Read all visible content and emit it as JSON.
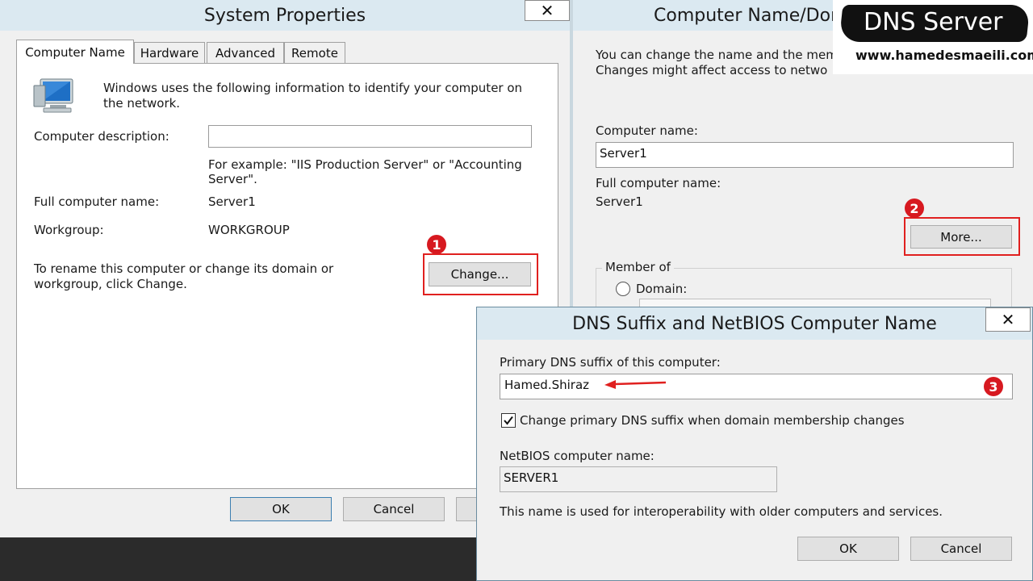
{
  "system_properties": {
    "title": "System Properties",
    "close_glyph": "✕",
    "tabs": [
      {
        "label": "Computer Name"
      },
      {
        "label": "Hardware"
      },
      {
        "label": "Advanced"
      },
      {
        "label": "Remote"
      }
    ],
    "intro_text_line1": "Windows uses the following information to identify your computer on",
    "intro_text_line2": "the network.",
    "description_label": "Computer description:",
    "description_value": "",
    "example_line1": "For example: \"IIS Production Server\" or \"Accounting",
    "example_line2": "Server\".",
    "full_name_label": "Full computer name:",
    "full_name_value": "Server1",
    "workgroup_label": "Workgroup:",
    "workgroup_value": "WORKGROUP",
    "rename_line1": "To rename this computer or change its domain or",
    "rename_line2": "workgroup, click Change.",
    "change_button": "Change...",
    "ok_button": "OK",
    "cancel_button": "Cancel"
  },
  "computer_name_domain": {
    "title": "Computer Name/Dom",
    "text_line1": "You can change the name and the mem",
    "text_line2": "Changes might affect access to netwo",
    "computer_name_label": "Computer name:",
    "computer_name_value": "Server1",
    "full_name_label": "Full computer name:",
    "full_name_value": "Server1",
    "more_button": "More...",
    "member_of_label": "Member of",
    "domain_label": "Domain:"
  },
  "dns_dialog": {
    "title": "DNS Suffix and NetBIOS Computer Name",
    "close_glyph": "✕",
    "suffix_label": "Primary DNS suffix of this computer:",
    "suffix_value": "Hamed.Shiraz",
    "checkbox_label": "Change primary DNS suffix when domain membership changes",
    "checkbox_checked": true,
    "netbios_label": "NetBIOS computer name:",
    "netbios_value": "SERVER1",
    "info_text": "This name is used for interoperability with older computers and services.",
    "ok_button": "OK",
    "cancel_button": "Cancel"
  },
  "annotations": {
    "badge1": "1",
    "badge2": "2",
    "badge3": "3",
    "accent_color": "#e0201f"
  },
  "watermark": {
    "title": "DNS Server",
    "url": "www.hamedesmaeili.com"
  }
}
